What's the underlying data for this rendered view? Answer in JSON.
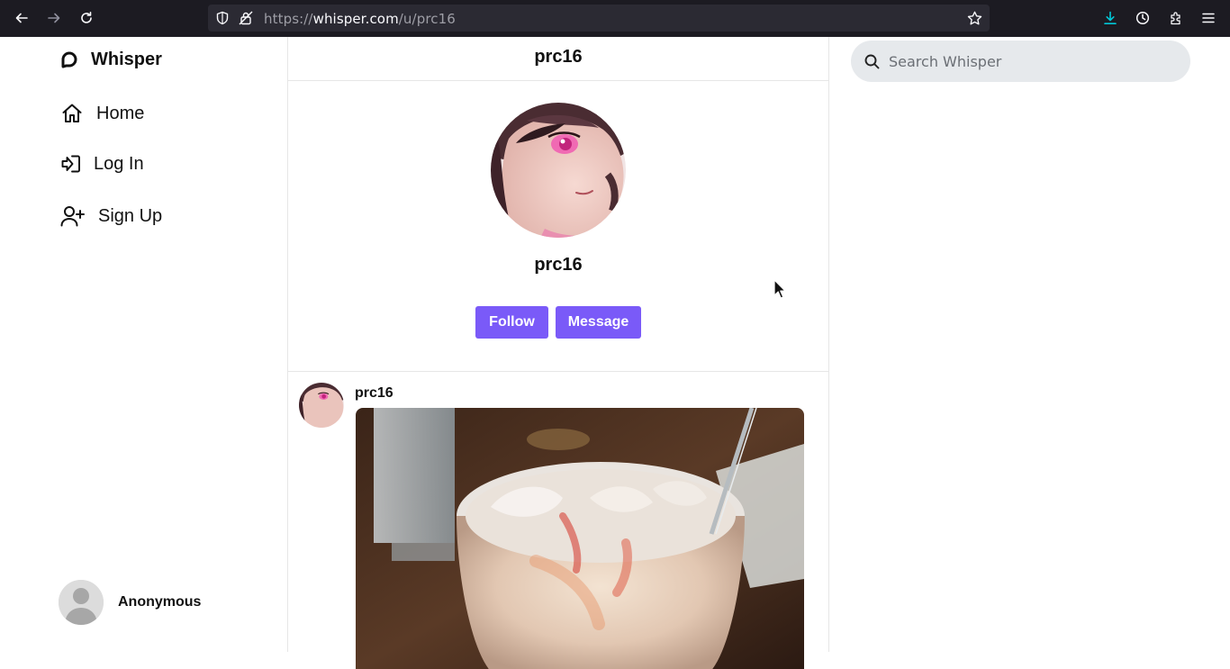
{
  "browser": {
    "url_prefix": "https://",
    "url_host": "whisper.com",
    "url_path": "/u/prc16",
    "icons": [
      "back-arrow-icon",
      "forward-arrow-icon",
      "reload-icon",
      "shield-icon",
      "lock-icon",
      "star-icon",
      "download-icon",
      "history-icon",
      "extensions-icon",
      "menu-icon"
    ]
  },
  "sidebar": {
    "brand": "Whisper",
    "items": [
      {
        "label": "Home",
        "icon": "home-icon"
      },
      {
        "label": "Log In",
        "icon": "log-in-icon"
      },
      {
        "label": "Sign Up",
        "icon": "user-plus-icon"
      }
    ],
    "user": {
      "name": "Anonymous",
      "icon": "default-avatar-icon"
    }
  },
  "main": {
    "header_title": "prc16",
    "profile": {
      "name": "prc16",
      "follow_label": "Follow",
      "message_label": "Message"
    },
    "post": {
      "author": "prc16"
    }
  },
  "search": {
    "placeholder": "Search Whisper"
  },
  "colors": {
    "accent": "#7a5af8",
    "chrome_bg": "#1c1b22",
    "urlbar_bg": "#2b2a33",
    "download_accent": "#00c8d7"
  }
}
